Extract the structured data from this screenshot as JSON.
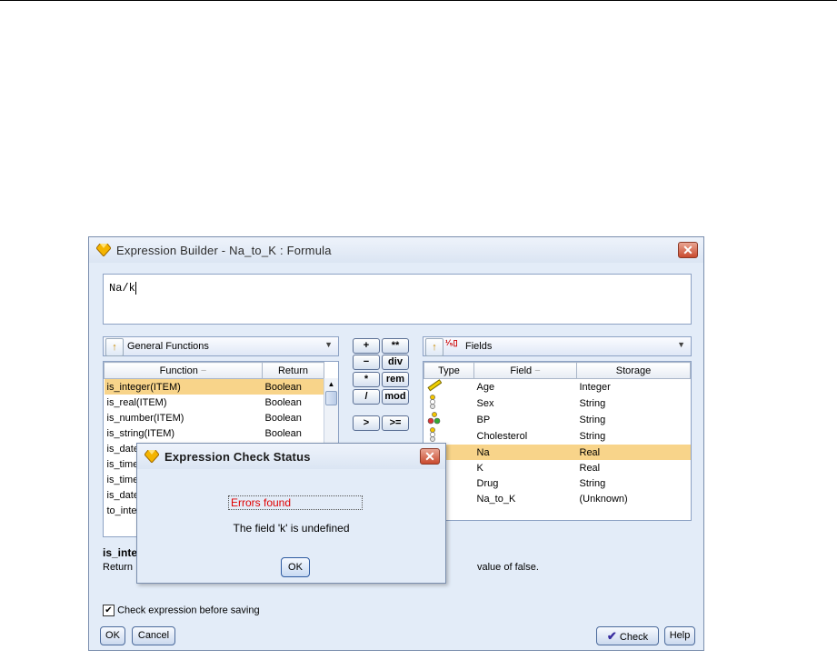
{
  "window": {
    "title": "Expression Builder - Na_to_K : Formula",
    "expression": "Na/k",
    "close_label": "✕"
  },
  "functions": {
    "category": "General Functions",
    "columns": [
      "Function",
      "Return"
    ],
    "rows": [
      {
        "name": "is_integer(ITEM)",
        "ret": "Boolean"
      },
      {
        "name": "is_real(ITEM)",
        "ret": "Boolean"
      },
      {
        "name": "is_number(ITEM)",
        "ret": "Boolean"
      },
      {
        "name": "is_string(ITEM)",
        "ret": "Boolean"
      },
      {
        "name": "is_date",
        "ret": ""
      },
      {
        "name": "is_time",
        "ret": ""
      },
      {
        "name": "is_time",
        "ret": ""
      },
      {
        "name": "is_date",
        "ret": ""
      },
      {
        "name": "to_inte",
        "ret": ""
      }
    ],
    "desc_title": "is_inte",
    "desc_left": "Return",
    "desc_right": "value of false."
  },
  "operators": [
    "+",
    "**",
    "−",
    "div",
    "*",
    "rem",
    "/",
    "mod",
    ">",
    ">="
  ],
  "fields": {
    "category": "Fields",
    "columns": [
      "Type",
      "Field",
      "Storage"
    ],
    "rows": [
      {
        "type": "ruler",
        "field": "Age",
        "storage": "Integer"
      },
      {
        "type": "set",
        "field": "Sex",
        "storage": "String"
      },
      {
        "type": "flag",
        "field": "BP",
        "storage": "String"
      },
      {
        "type": "set",
        "field": "Cholesterol",
        "storage": "String"
      },
      {
        "type": "",
        "field": "Na",
        "storage": "Real"
      },
      {
        "type": "",
        "field": "K",
        "storage": "Real"
      },
      {
        "type": "",
        "field": "Drug",
        "storage": "String"
      },
      {
        "type": "",
        "field": "Na_to_K",
        "storage": "(Unknown)"
      }
    ]
  },
  "footer": {
    "check_before_saving": "Check expression before saving",
    "ok": "OK",
    "cancel": "Cancel",
    "check": "Check",
    "help": "Help"
  },
  "dialog": {
    "title": "Expression Check Status",
    "error": "Errors found",
    "message": "The field 'k' is undefined",
    "ok": "OK"
  },
  "colors": {
    "selection": "#f8d48a",
    "error_text": "#e00000",
    "window_bg": "#e3ecf8"
  }
}
